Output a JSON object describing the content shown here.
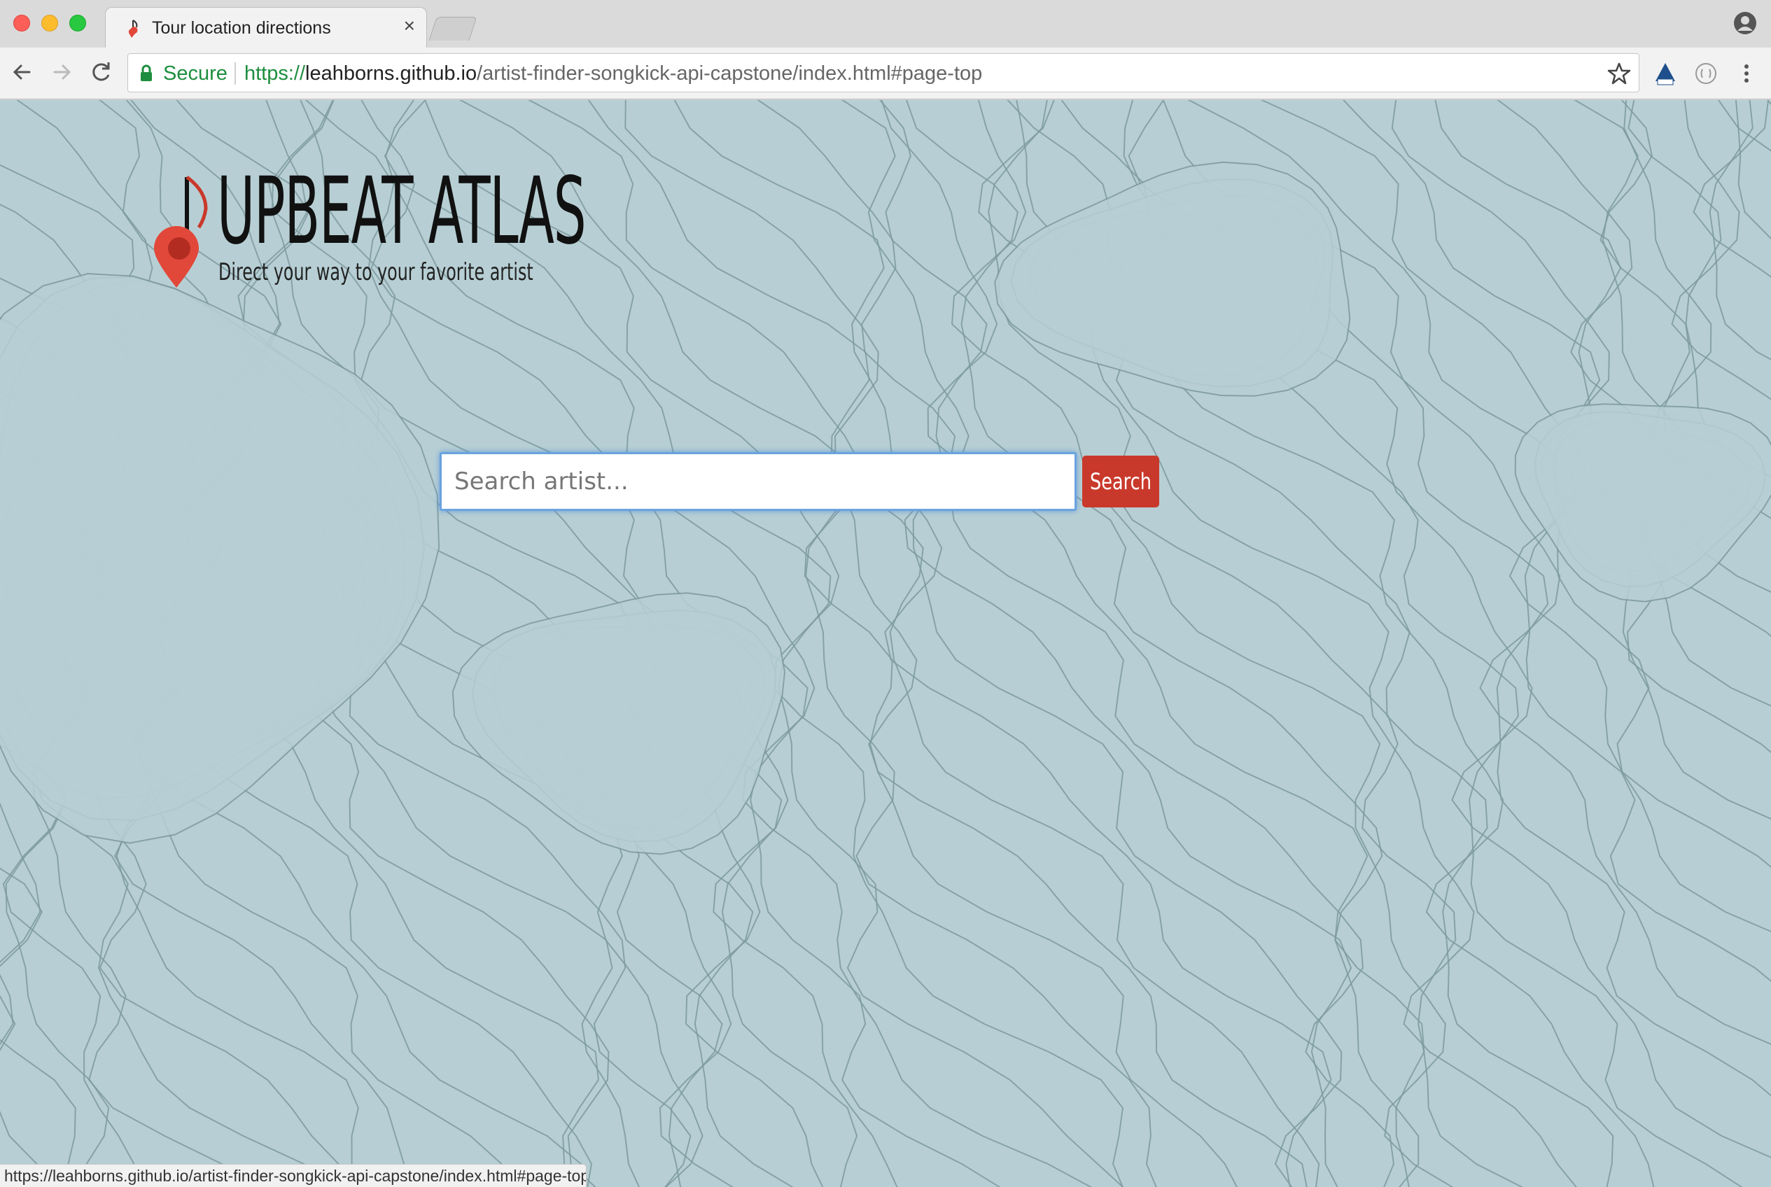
{
  "browser": {
    "tab": {
      "title": "Tour location directions",
      "close_glyph": "×"
    },
    "address_bar": {
      "security_label": "Secure",
      "url_scheme": "https://",
      "url_host": "leahborns.github.io",
      "url_path": "/artist-finder-songkick-api-capstone/index.html#page-top"
    },
    "status_url": "https://leahborns.github.io/artist-finder-songkick-api-capstone/index.html#page-top",
    "icons": [
      "back-arrow-icon",
      "forward-arrow-icon",
      "reload-icon",
      "lock-icon",
      "bookmark-star-icon",
      "axe-extension-icon",
      "extension-circle-icon",
      "more-menu-icon",
      "profile-icon"
    ]
  },
  "page": {
    "logo": {
      "title": "UPBEAT ATLAS",
      "tagline": "Direct your way to your favorite artist",
      "icon": "music-note-map-pin-icon"
    },
    "search": {
      "placeholder": "Search artist...",
      "value": "",
      "button_label": "Search"
    }
  },
  "colors": {
    "page_background": "#b7cfd4",
    "contour_lines": "#7e9a9f",
    "search_button": "#c9392b",
    "pin": "#e2483a",
    "focus_ring": "#6aa3e0",
    "secure_green": "#1e8e3e"
  }
}
